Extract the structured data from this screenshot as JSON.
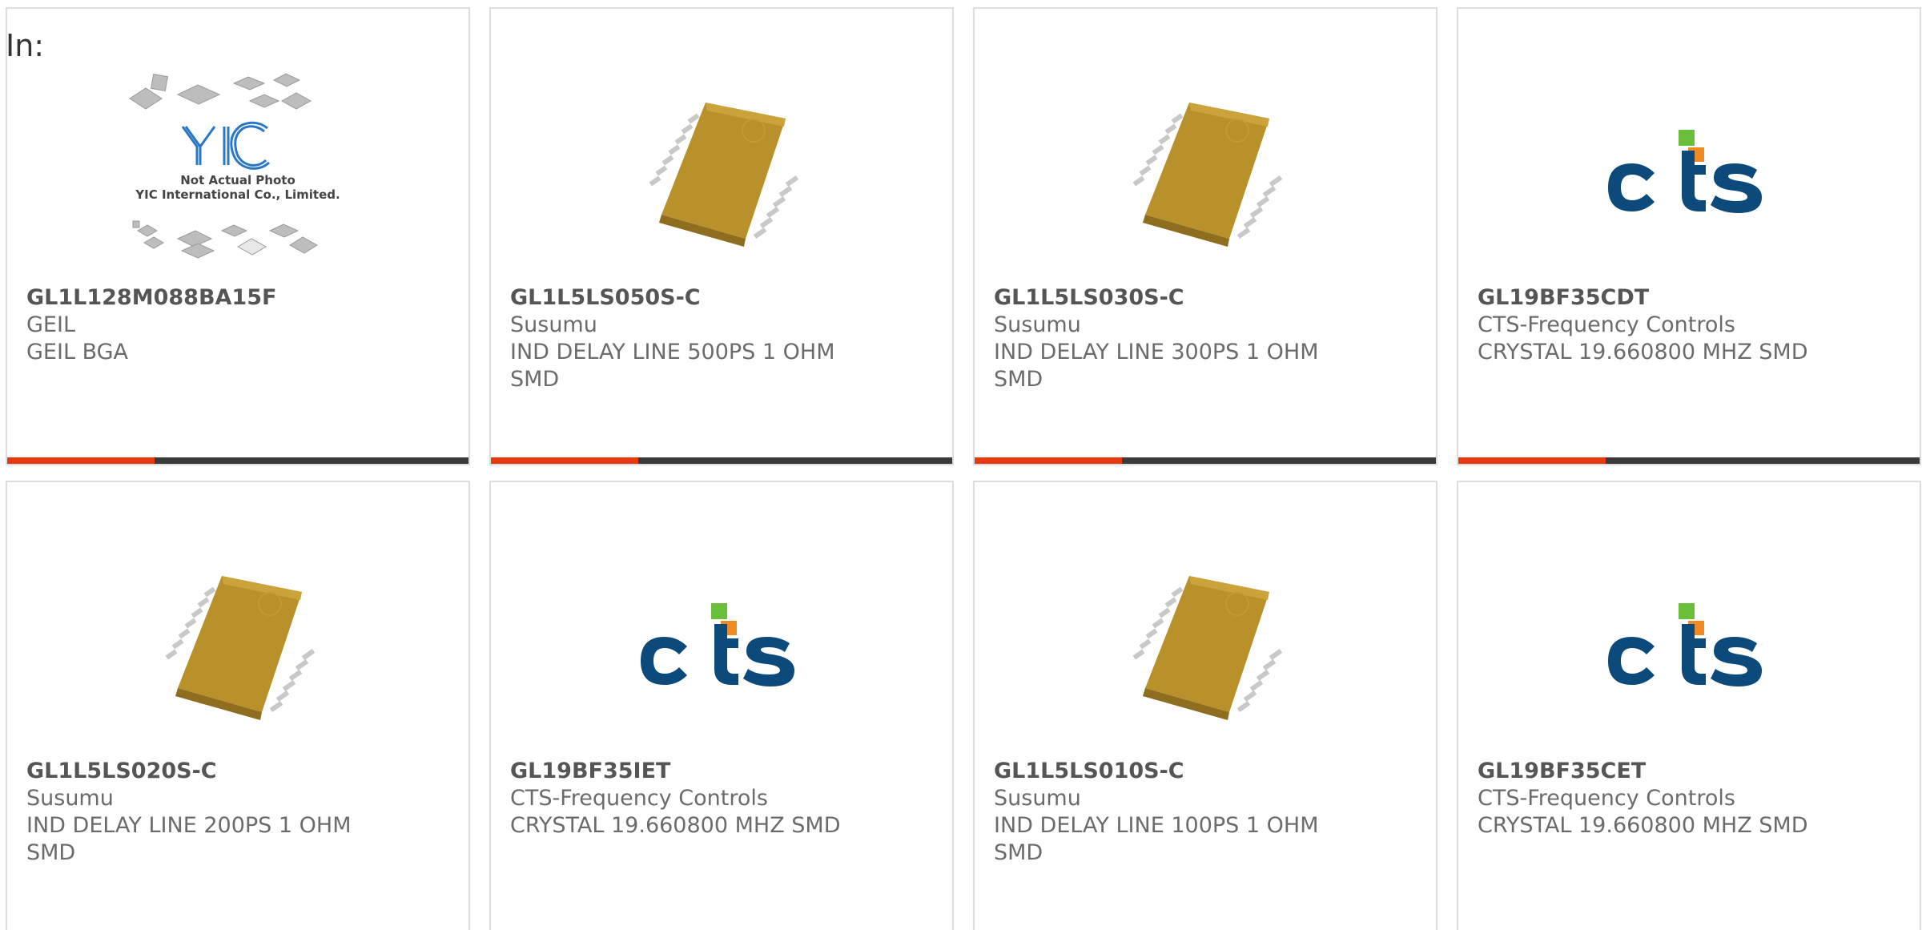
{
  "header": {
    "label": "In:"
  },
  "colors": {
    "accent": "#e8380d",
    "bar_track": "#3a3a3a",
    "chip": "#b8912a",
    "cts_blue": "#0b4a7a",
    "cts_green": "#6abf3a",
    "cts_orange": "#f08a24"
  },
  "cards": [
    {
      "part_no": "GL1L128M088BA15F",
      "maker": "GEIL",
      "desc": "GEIL BGA",
      "image": "not-actual-photo",
      "photo_note_1": "Not Actual Photo",
      "photo_note_2": "YIC International Co., Limited.",
      "logo_text": "YIC",
      "progress": 0.32
    },
    {
      "part_no": "GL1L5LS050S-C",
      "maker": "Susumu",
      "desc": "IND DELAY LINE 500PS 1 OHM SMD",
      "image": "chip",
      "progress": 0.32
    },
    {
      "part_no": "GL1L5LS030S-C",
      "maker": "Susumu",
      "desc": "IND DELAY LINE 300PS 1 OHM SMD",
      "image": "chip",
      "progress": 0.32
    },
    {
      "part_no": "GL19BF35CDT",
      "maker": "CTS-Frequency Controls",
      "desc": "CRYSTAL 19.660800 MHZ SMD",
      "image": "cts-logo",
      "progress": 0.32
    },
    {
      "part_no": "GL1L5LS020S-C",
      "maker": "Susumu",
      "desc": "IND DELAY LINE 200PS 1 OHM SMD",
      "image": "chip",
      "progress": 0
    },
    {
      "part_no": "GL19BF35IET",
      "maker": "CTS-Frequency Controls",
      "desc": "CRYSTAL 19.660800 MHZ SMD",
      "image": "cts-logo",
      "progress": 0
    },
    {
      "part_no": "GL1L5LS010S-C",
      "maker": "Susumu",
      "desc": "IND DELAY LINE 100PS 1 OHM SMD",
      "image": "chip",
      "progress": 0
    },
    {
      "part_no": "GL19BF35CET",
      "maker": "CTS-Frequency Controls",
      "desc": "CRYSTAL 19.660800 MHZ SMD",
      "image": "cts-logo",
      "progress": 0
    }
  ]
}
